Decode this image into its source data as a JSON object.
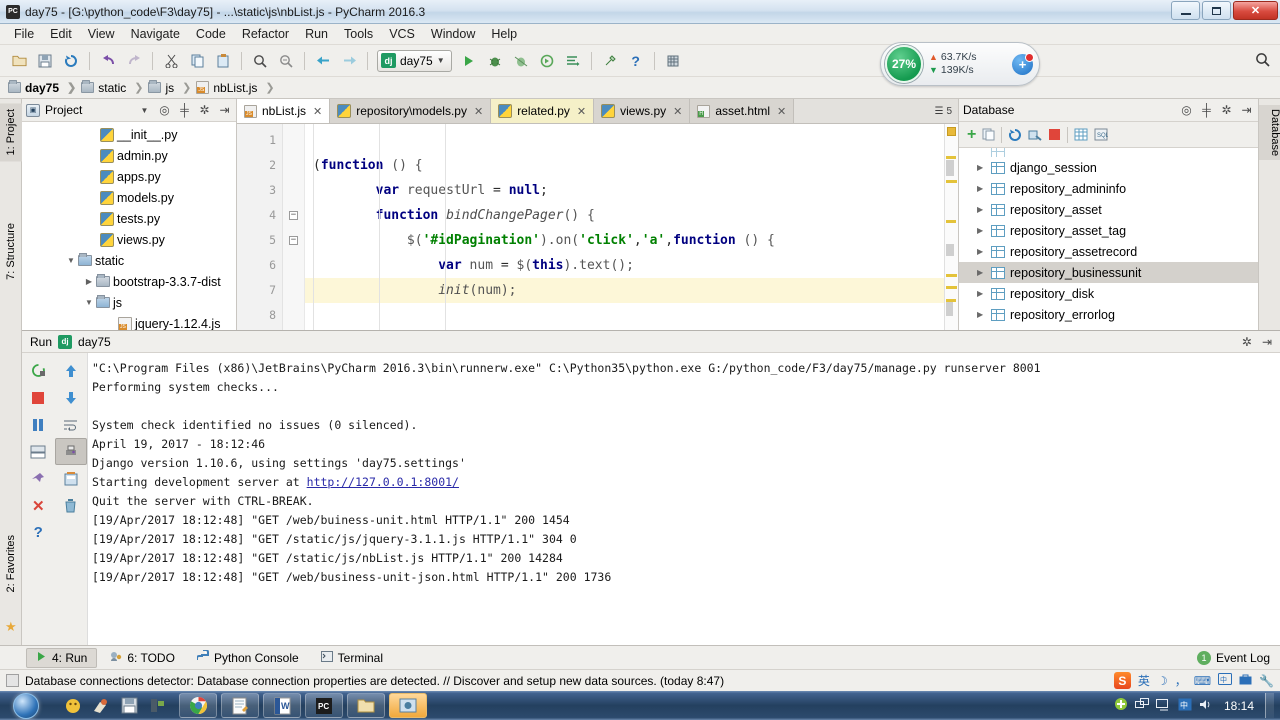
{
  "window": {
    "title": "day75 - [G:\\python_code\\F3\\day75] - ...\\static\\js\\nbList.js - PyCharm 2016.3",
    "app_badge": "PC",
    "controls": {
      "minimize": "minimize-button",
      "maximize": "maximize-button",
      "close": "✕"
    }
  },
  "menu": {
    "items": [
      "File",
      "Edit",
      "View",
      "Navigate",
      "Code",
      "Refactor",
      "Run",
      "Tools",
      "VCS",
      "Window",
      "Help"
    ]
  },
  "toolbar": {
    "icons": [
      "open-folder-icon",
      "save-all-icon",
      "sync-icon",
      "undo-icon",
      "redo-icon",
      "cut-icon",
      "copy-icon",
      "paste-icon",
      "find-icon",
      "replace-icon",
      "back-icon",
      "forward-icon"
    ],
    "run_config": {
      "label": "day75",
      "badge": "dj"
    },
    "action_icons": [
      "run-icon",
      "debug-icon",
      "coverage-icon",
      "profile-icon",
      "attach-icon",
      "settings-icon",
      "help-icon",
      "database-icon"
    ],
    "search_icon": "search-icon",
    "network_monitor": {
      "percent": "27%",
      "upload": "63.7K/s",
      "download": "139K/s",
      "badge": "+"
    }
  },
  "breadcrumb": [
    {
      "label": "day75",
      "icon": "folder-icon",
      "bold": true
    },
    {
      "label": "static",
      "icon": "folder-icon",
      "bold": false
    },
    {
      "label": "js",
      "icon": "folder-icon",
      "bold": false
    },
    {
      "label": "nbList.js",
      "icon": "js-file-icon",
      "bold": false
    }
  ],
  "left_strip": {
    "tabs": [
      "1: Project",
      "7: Structure"
    ],
    "favorites": "2: Favorites"
  },
  "right_strip": {
    "tabs": [
      "Database"
    ]
  },
  "project_panel": {
    "title": "Project",
    "header_icons": [
      "locate-icon",
      "collapse-all-icon",
      "settings-icon",
      "hide-icon"
    ],
    "tree": [
      {
        "label": "__init__.py",
        "icon": "python-file-icon",
        "depth": 3,
        "arrow": ""
      },
      {
        "label": "admin.py",
        "icon": "python-file-icon",
        "depth": 3,
        "arrow": ""
      },
      {
        "label": "apps.py",
        "icon": "python-file-icon",
        "depth": 3,
        "arrow": ""
      },
      {
        "label": "models.py",
        "icon": "python-file-icon",
        "depth": 3,
        "arrow": ""
      },
      {
        "label": "tests.py",
        "icon": "python-file-icon",
        "depth": 3,
        "arrow": ""
      },
      {
        "label": "views.py",
        "icon": "python-file-icon",
        "depth": 3,
        "arrow": ""
      },
      {
        "label": "static",
        "icon": "folder-open-icon",
        "depth": 1,
        "arrow": "▼"
      },
      {
        "label": "bootstrap-3.3.7-dist",
        "icon": "folder-icon",
        "depth": 2,
        "arrow": "▶"
      },
      {
        "label": "js",
        "icon": "folder-open-icon",
        "depth": 2,
        "arrow": "▼"
      },
      {
        "label": "jquery-1.12.4.js",
        "icon": "js-file-icon",
        "depth": 3,
        "arrow": ""
      }
    ]
  },
  "editor": {
    "tabs": [
      {
        "label": "nbList.js",
        "icon": "js-file-icon",
        "state": "active"
      },
      {
        "label": "repository\\models.py",
        "icon": "python-file-icon",
        "state": "normal"
      },
      {
        "label": "related.py",
        "icon": "python-file-icon",
        "state": "modified"
      },
      {
        "label": "views.py",
        "icon": "python-file-icon",
        "state": "normal"
      },
      {
        "label": "asset.html",
        "icon": "html-file-icon",
        "state": "normal"
      }
    ],
    "tab_overflow_count": "5",
    "line_numbers": [
      "1",
      "2",
      "3",
      "4",
      "5",
      "6",
      "7",
      "8"
    ],
    "code_lines": [
      {
        "n": 1,
        "text": ""
      },
      {
        "n": 2,
        "text": "(function () {"
      },
      {
        "n": 3,
        "text": "    var requestUrl = null;"
      },
      {
        "n": 4,
        "text": "    function bindChangePager() {"
      },
      {
        "n": 5,
        "text": "        $('#idPagination').on('click','a',function () {"
      },
      {
        "n": 6,
        "text": "            var num = $(this).text();"
      },
      {
        "n": 7,
        "text": "            init(num);"
      },
      {
        "n": 8,
        "text": ""
      }
    ],
    "highlight_line": 7
  },
  "database_panel": {
    "title": "Database",
    "header_icons": [
      "locate-icon",
      "collapse-all-icon",
      "settings-icon",
      "hide-icon"
    ],
    "toolbar_icons": [
      "add-icon",
      "copy-icon",
      "sync-icon",
      "datasource-properties-icon",
      "stop-icon",
      "table-icon",
      "console-icon"
    ],
    "tables": [
      {
        "label": "django_session",
        "selected": false
      },
      {
        "label": "repository_admininfo",
        "selected": false
      },
      {
        "label": "repository_asset",
        "selected": false
      },
      {
        "label": "repository_asset_tag",
        "selected": false
      },
      {
        "label": "repository_assetrecord",
        "selected": false
      },
      {
        "label": "repository_businessunit",
        "selected": true
      },
      {
        "label": "repository_disk",
        "selected": false
      },
      {
        "label": "repository_errorlog",
        "selected": false
      }
    ]
  },
  "run_window": {
    "title": "Run",
    "config_name": "day75",
    "config_badge": "dj",
    "header_icons": [
      "settings-icon",
      "hide-icon"
    ],
    "sidebar_icons_col1": [
      "rerun-icon",
      "stop-icon",
      "pause-icon",
      "layout-icon",
      "pin-icon",
      "close-icon",
      "help-icon"
    ],
    "sidebar_icons_col2": [
      "up-icon",
      "down-icon",
      "soft-wrap-icon",
      "print-icon",
      "export-icon",
      "trash-icon"
    ],
    "console_lines": [
      {
        "text": "\"C:\\Program Files (x86)\\JetBrains\\PyCharm 2016.3\\bin\\runnerw.exe\" C:\\Python35\\python.exe G:/python_code/F3/day75/manage.py runserver 8001",
        "link": false
      },
      {
        "text": "Performing system checks...",
        "link": false
      },
      {
        "text": "",
        "link": false
      },
      {
        "text": "System check identified no issues (0 silenced).",
        "link": false
      },
      {
        "text": "April 19, 2017 - 18:12:46",
        "link": false
      },
      {
        "text": "Django version 1.10.6, using settings 'day75.settings'",
        "link": false
      },
      {
        "text": "Starting development server at ",
        "link": true,
        "link_text": "http://127.0.0.1:8001/"
      },
      {
        "text": "Quit the server with CTRL-BREAK.",
        "link": false
      },
      {
        "text": "[19/Apr/2017 18:12:48] \"GET /web/buiness-unit.html HTTP/1.1\" 200 1454",
        "link": false
      },
      {
        "text": "[19/Apr/2017 18:12:48] \"GET /static/js/jquery-3.1.1.js HTTP/1.1\" 304 0",
        "link": false
      },
      {
        "text": "[19/Apr/2017 18:12:48] \"GET /static/js/nbList.js HTTP/1.1\" 200 14284",
        "link": false
      },
      {
        "text": "[19/Apr/2017 18:12:48] \"GET /web/business-unit-json.html HTTP/1.1\" 200 1736",
        "link": false
      }
    ]
  },
  "bottom_tabs": {
    "items": [
      {
        "label": "4: Run",
        "icon": "run-icon",
        "active": true
      },
      {
        "label": "6: TODO",
        "icon": "todo-icon",
        "active": false
      },
      {
        "label": "Python Console",
        "icon": "python-icon",
        "active": false
      },
      {
        "label": "Terminal",
        "icon": "terminal-icon",
        "active": false
      }
    ],
    "event_log": {
      "label": "Event Log",
      "count": "1"
    }
  },
  "status_bar": {
    "message": "Database connections detector: Database connection properties are detected. // Discover and setup new data sources. (today 8:47)",
    "ime_icons": [
      "sogou-icon",
      "chinese-english-icon",
      "moon-icon",
      "comma-icon",
      "keyboard-icon",
      "input-method-icon",
      "toolbox-icon",
      "wrench-icon"
    ],
    "ime_mode": "英"
  },
  "taskbar": {
    "start": "start-orb",
    "quick_launch": [
      "media-icon",
      "paint-icon",
      "save-icon",
      "gadget-icon"
    ],
    "apps": [
      {
        "icon": "chrome-icon",
        "active": false
      },
      {
        "icon": "notepad-icon",
        "active": false
      },
      {
        "icon": "word-icon",
        "active": false
      },
      {
        "icon": "pycharm-icon",
        "active": false
      },
      {
        "icon": "folder-icon",
        "active": false
      },
      {
        "icon": "screenshot-icon",
        "active": true
      }
    ],
    "tray": [
      "shield-icon",
      "network-icon",
      "monitor-icon",
      "ime-icon",
      "volume-icon"
    ],
    "clock": "18:14"
  }
}
